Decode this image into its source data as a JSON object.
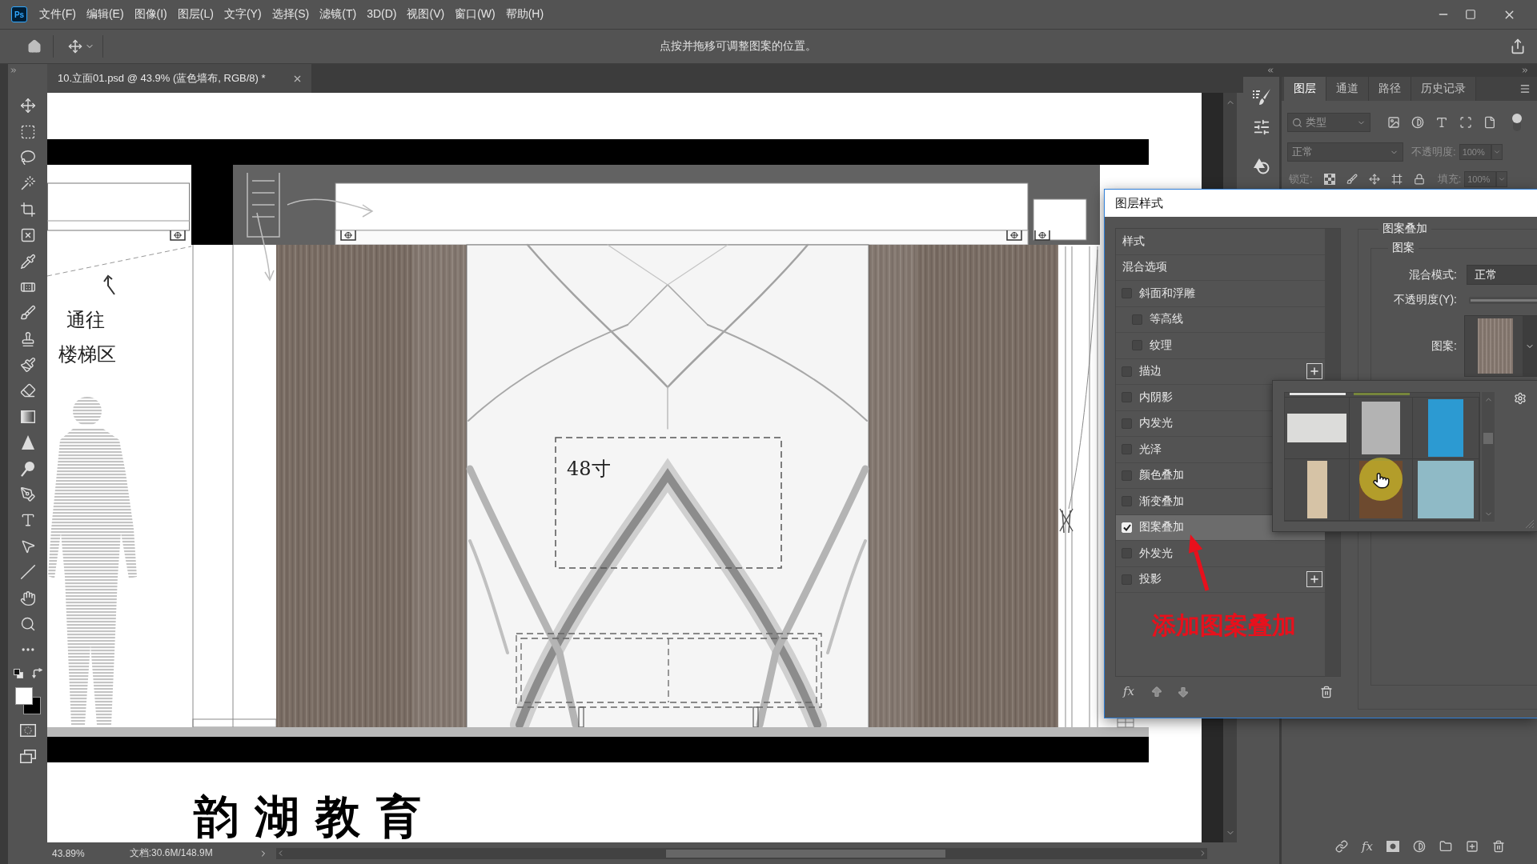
{
  "app": {
    "logo": "Ps"
  },
  "menu_bar": {
    "items": [
      "文件(F)",
      "编辑(E)",
      "图像(I)",
      "图层(L)",
      "文字(Y)",
      "选择(S)",
      "滤镜(T)",
      "3D(D)",
      "视图(V)",
      "窗口(W)",
      "帮助(H)"
    ]
  },
  "options_bar": {
    "hint": "点按并拖移可调整图案的位置。"
  },
  "document_tab": {
    "title": "10.立面01.psd @ 43.9% (蓝色墙布, RGB/8) *"
  },
  "canvas": {
    "stairs_label": [
      "通往",
      "楼梯区"
    ],
    "tv_label": "48寸",
    "title": "韵湖教育"
  },
  "status_bar": {
    "zoom": "43.89%",
    "document_size": "文档:30.6M/148.9M"
  },
  "layers_panel": {
    "tabs": [
      {
        "label": "图层",
        "selected": true
      },
      {
        "label": "通道",
        "selected": false
      },
      {
        "label": "路径",
        "selected": false
      },
      {
        "label": "历史记录",
        "selected": false
      }
    ],
    "filter": "类型",
    "blend_mode": "正常",
    "opacity_label": "不透明度:",
    "opacity": "100%",
    "lock_label": "锁定:",
    "fill_label": "填充:",
    "fill": "100%",
    "effects_button": "fx"
  },
  "layer_style_dialog": {
    "title": "图层样式",
    "styles": [
      {
        "label": "样式",
        "kind": "plain",
        "selected": false
      },
      {
        "label": "混合选项",
        "kind": "plain",
        "selected": false
      },
      {
        "label": "斜面和浮雕",
        "kind": "check",
        "checked": false,
        "selected": false,
        "add_button": false,
        "children": [
          {
            "label": "等高线",
            "kind": "check",
            "checked": false,
            "selected": false
          },
          {
            "label": "纹理",
            "kind": "check",
            "checked": false,
            "selected": false
          }
        ]
      },
      {
        "label": "描边",
        "kind": "check",
        "checked": false,
        "selected": false,
        "add_button": true
      },
      {
        "label": "内阴影",
        "kind": "check",
        "checked": false,
        "selected": false,
        "add_button": false
      },
      {
        "label": "内发光",
        "kind": "check",
        "checked": false,
        "selected": false,
        "add_button": false
      },
      {
        "label": "光泽",
        "kind": "check",
        "checked": false,
        "selected": false,
        "add_button": false
      },
      {
        "label": "颜色叠加",
        "kind": "check",
        "checked": false,
        "selected": false,
        "add_button": false
      },
      {
        "label": "渐变叠加",
        "kind": "check",
        "checked": false,
        "selected": false,
        "add_button": false
      },
      {
        "label": "图案叠加",
        "kind": "check",
        "checked": true,
        "selected": true,
        "add_button": false
      },
      {
        "label": "外发光",
        "kind": "check",
        "checked": false,
        "selected": false,
        "add_button": false
      },
      {
        "label": "投影",
        "kind": "check",
        "checked": false,
        "selected": false,
        "add_button": true
      }
    ],
    "effects_button": "fx",
    "section_title": "图案叠加",
    "group_title": "图案",
    "blend_mode_label": "混合模式:",
    "blend_mode": "正常",
    "opacity_label": "不透明度(Y):",
    "opacity_slider": {
      "level": 1
    },
    "pattern_label": "图案:"
  },
  "pattern_picker": {
    "swatches": [
      {
        "kind": "partial",
        "color": "#e4e4e4",
        "hovered": false
      },
      {
        "kind": "partial",
        "color": "#76863c",
        "hovered": false
      },
      {
        "kind": "full",
        "color": "#dcdcda",
        "hovered": false
      },
      {
        "kind": "full",
        "color": "#b3b3b3",
        "hovered": false
      },
      {
        "kind": "full",
        "color": "#2c9ad2",
        "hovered": false
      },
      {
        "kind": "full",
        "color": "#d6c3a6",
        "hovered": false
      },
      {
        "kind": "full",
        "color": "#6d4a2f",
        "hovered": true
      },
      {
        "kind": "full",
        "color": "#8fbac6",
        "hovered": false
      }
    ]
  },
  "annotation": {
    "text": "添加图案叠加"
  }
}
